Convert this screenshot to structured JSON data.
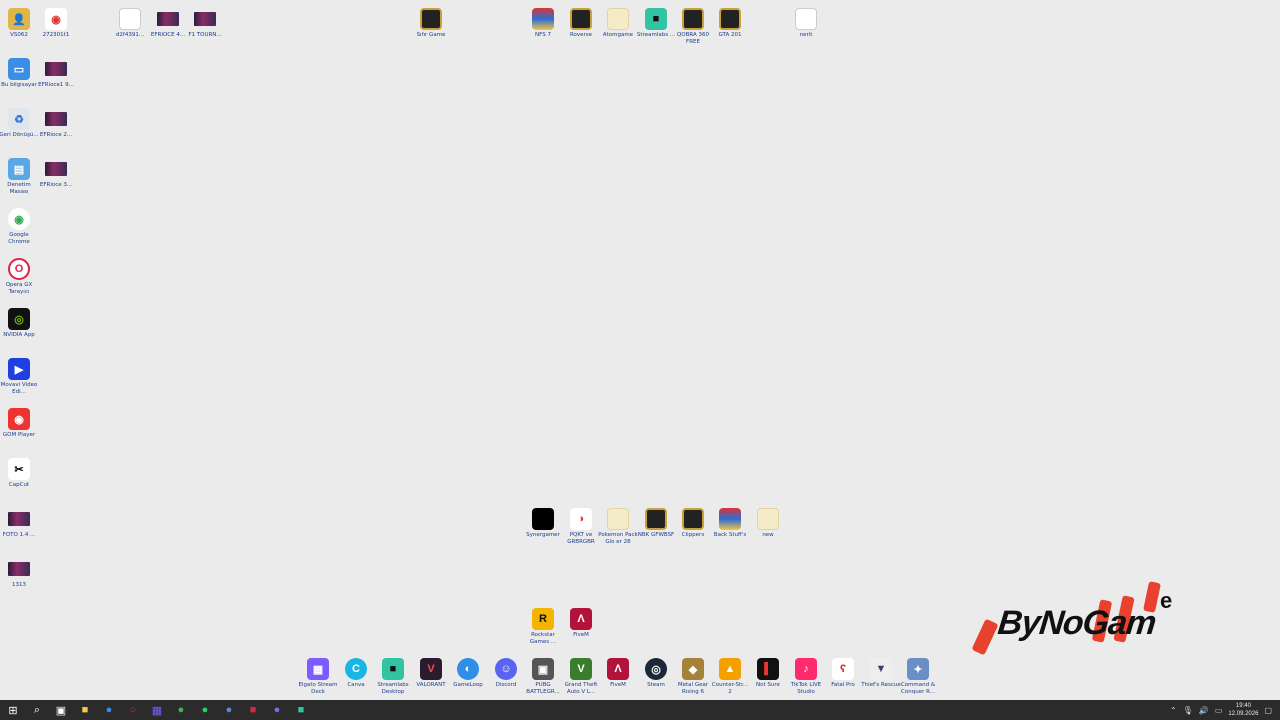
{
  "desktop": {
    "icons": [
      {
        "id": "i1",
        "label": "VS062",
        "kind": "person"
      },
      {
        "id": "i2",
        "label": "272301t1",
        "kind": "chrome-file"
      },
      {
        "id": "i3",
        "label": "Bu bilgisayar",
        "kind": "pc"
      },
      {
        "id": "i4",
        "label": "EFRioce1 9...",
        "kind": "thumb"
      },
      {
        "id": "i5",
        "label": "Geri Dönüşü...",
        "kind": "recycle"
      },
      {
        "id": "i6",
        "label": "EFRioce 2...",
        "kind": "thumb"
      },
      {
        "id": "i7",
        "label": "Denetim Masası",
        "kind": "control"
      },
      {
        "id": "i8",
        "label": "EFRioce 3...",
        "kind": "thumb"
      },
      {
        "id": "i9",
        "label": "Google Chrome",
        "kind": "chrome"
      },
      {
        "id": "i10",
        "label": "Opera GX Tarayıcı",
        "kind": "opera"
      },
      {
        "id": "i11",
        "label": "NVIDIA App",
        "kind": "nvidia"
      },
      {
        "id": "i12",
        "label": "Movavi Video Edi...",
        "kind": "movavi"
      },
      {
        "id": "i13",
        "label": "GOM Player",
        "kind": "gom"
      },
      {
        "id": "i14",
        "label": "CapCut",
        "kind": "capcut"
      },
      {
        "id": "i15",
        "label": "FOTO 1.4 ...",
        "kind": "thumb"
      },
      {
        "id": "i16",
        "label": "1313",
        "kind": "thumb"
      },
      {
        "id": "i17",
        "label": "d2f4391...",
        "kind": "doc"
      },
      {
        "id": "i18",
        "label": "EFRIOCE 4...",
        "kind": "thumb"
      },
      {
        "id": "i19",
        "label": "F1 TOURN...",
        "kind": "thumb"
      },
      {
        "id": "i20",
        "label": "Sıfır Game",
        "kind": "folder-dark"
      },
      {
        "id": "i21",
        "label": "NFS 7",
        "kind": "folder-color"
      },
      {
        "id": "i22",
        "label": "Roverse",
        "kind": "folder-dark"
      },
      {
        "id": "i23",
        "label": "Atomgame",
        "kind": "folder-pale"
      },
      {
        "id": "i24",
        "label": "Streamlabs ...",
        "kind": "streamlabs"
      },
      {
        "id": "i25",
        "label": "QOBRA 360 FREE",
        "kind": "folder-dark"
      },
      {
        "id": "i26",
        "label": "GTA 201",
        "kind": "folder-dark"
      },
      {
        "id": "i27",
        "label": "nerit",
        "kind": "doc"
      },
      {
        "id": "i28",
        "label": "Synergamer",
        "kind": "black"
      },
      {
        "id": "i29",
        "label": "PQKT ve GRBRGBR",
        "kind": "pokeball"
      },
      {
        "id": "i30",
        "label": "Pokemon Pack Glo er 28",
        "kind": "folder-pale"
      },
      {
        "id": "i31",
        "label": "NBK GFWBSF",
        "kind": "folder-dark"
      },
      {
        "id": "i32",
        "label": "Clippers",
        "kind": "folder-dark"
      },
      {
        "id": "i33",
        "label": "Back Stuff's",
        "kind": "folder-color"
      },
      {
        "id": "i34",
        "label": "new",
        "kind": "folder-pale"
      },
      {
        "id": "i35",
        "label": "Rockstar Games ...",
        "kind": "rockstar"
      },
      {
        "id": "i36",
        "label": "FiveM",
        "kind": "fivem"
      },
      {
        "id": "i37",
        "label": "Elgato Stream Deck",
        "kind": "elgato"
      },
      {
        "id": "i38",
        "label": "Canva",
        "kind": "canva"
      },
      {
        "id": "i39",
        "label": "Streamlabs Desktop",
        "kind": "streamlabs"
      },
      {
        "id": "i40",
        "label": "VALORANT",
        "kind": "valorant"
      },
      {
        "id": "i41",
        "label": "GameLoop",
        "kind": "gameloop"
      },
      {
        "id": "i42",
        "label": "Discord",
        "kind": "discord"
      },
      {
        "id": "i43",
        "label": "PUBG BATTLEGR...",
        "kind": "pubg"
      },
      {
        "id": "i44",
        "label": "Grand Theft Auto V L...",
        "kind": "gtav"
      },
      {
        "id": "i45",
        "label": "FiveM",
        "kind": "fivem"
      },
      {
        "id": "i46",
        "label": "Steam",
        "kind": "steam"
      },
      {
        "id": "i47",
        "label": "Metal Gear Rising 6",
        "kind": "mgr"
      },
      {
        "id": "i48",
        "label": "Counter-Str... 2",
        "kind": "cs2"
      },
      {
        "id": "i49",
        "label": "Not Sure",
        "kind": "roblox"
      },
      {
        "id": "i50",
        "label": "TikTok LIVE Studio",
        "kind": "tiktok"
      },
      {
        "id": "i51",
        "label": "Fatal Pro",
        "kind": "fatal"
      },
      {
        "id": "i52",
        "label": "Thief's Rescue",
        "kind": "destiny"
      },
      {
        "id": "i53",
        "label": "Command & Conquer R...",
        "kind": "cnc"
      }
    ]
  },
  "watermark": {
    "text": "ByNoGam",
    "suffix": "e"
  },
  "taskbar": {
    "items": [
      {
        "name": "start",
        "glyph": "⊞",
        "color": "#ffffff"
      },
      {
        "name": "search",
        "glyph": "⌕",
        "color": "#ffffff"
      },
      {
        "name": "taskview",
        "glyph": "▣",
        "color": "#ffffff"
      },
      {
        "name": "explorer",
        "glyph": "■",
        "color": "#f2c94c"
      },
      {
        "name": "edge",
        "glyph": "●",
        "color": "#2f8ee6"
      },
      {
        "name": "opera",
        "glyph": "○",
        "color": "#e0224b"
      },
      {
        "name": "streamdeck",
        "glyph": "▦",
        "color": "#7b5cff"
      },
      {
        "name": "chrome",
        "glyph": "●",
        "color": "#4caf50"
      },
      {
        "name": "spotify",
        "glyph": "●",
        "color": "#1ed760"
      },
      {
        "name": "steam",
        "glyph": "●",
        "color": "#5b8ccf"
      },
      {
        "name": "app-red",
        "glyph": "■",
        "color": "#d62839"
      },
      {
        "name": "discord",
        "glyph": "●",
        "color": "#7a6cf0"
      },
      {
        "name": "streamlabs",
        "glyph": "■",
        "color": "#31c3a2"
      }
    ],
    "tray": {
      "time": "19:40",
      "date": "12.09.2026"
    }
  }
}
